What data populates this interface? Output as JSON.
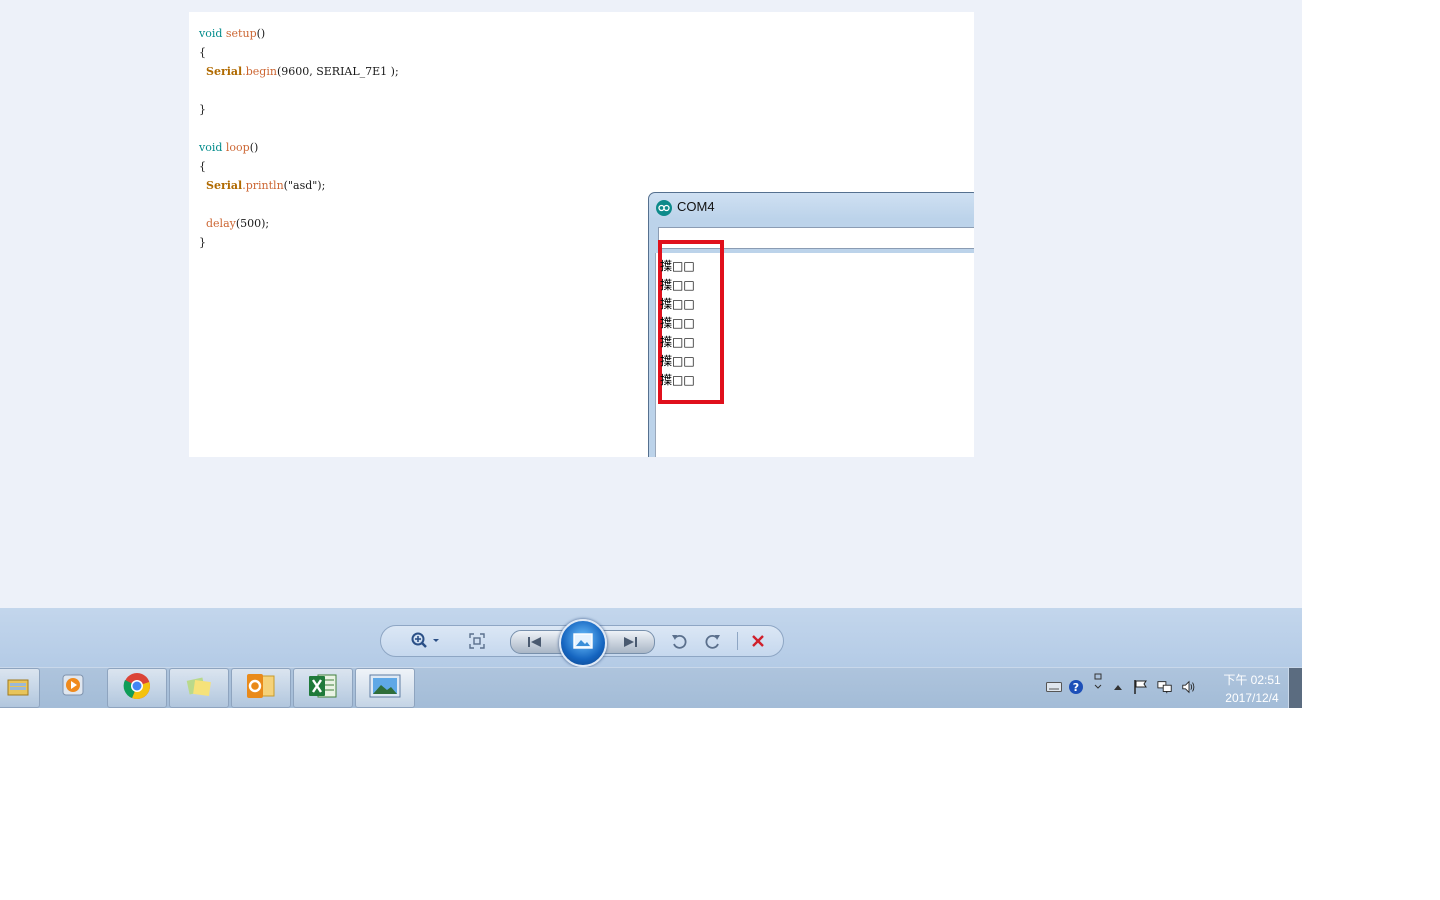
{
  "code": {
    "lines": [
      {
        "kw": "void",
        "fn": "setup",
        "rest": "()"
      },
      {
        "rest": "{"
      },
      {
        "indent": "  ",
        "cls": "Serial",
        "fn": ".begin",
        "rest": "(9600, SERIAL_7E1 );"
      },
      {
        "rest": ""
      },
      {
        "rest": "}"
      },
      {
        "rest": ""
      },
      {
        "kw": "void",
        "fn": "loop",
        "rest": "()"
      },
      {
        "rest": "{"
      },
      {
        "indent": "  ",
        "cls": "Serial",
        "fn": ".println",
        "rest": "(\"asd\");"
      },
      {
        "rest": ""
      },
      {
        "indent": "  ",
        "fn": "delay",
        "rest": "(500);"
      },
      {
        "rest": "}"
      }
    ]
  },
  "serial_monitor": {
    "title": "COM4",
    "icon": "arduino-icon",
    "output_lines": [
      "擛□□",
      "擛□□",
      "擛□□",
      "擛□□",
      "擛□□",
      "擛□□",
      "擛□□"
    ],
    "highlight_color": "#e0101c"
  },
  "viewer_toolbar": {
    "zoom": "zoom-icon",
    "fit": "actual-size-icon",
    "previous": "previous-icon",
    "slideshow": "slideshow-icon",
    "next": "next-icon",
    "rotate_left": "rotate-ccw-icon",
    "rotate_right": "rotate-cw-icon",
    "delete": "delete-icon"
  },
  "taskbar": {
    "apps": [
      "file-explorer-icon",
      "media-player-icon",
      "chrome-icon",
      "sticky-notes-icon",
      "outlook-icon",
      "excel-icon",
      "photo-viewer-icon"
    ],
    "tray": {
      "clock_time": "下午 02:51",
      "clock_date": "2017/12/4"
    }
  },
  "colors": {
    "viewer_bg": "#edf1f9",
    "keyword": "#008b8b",
    "function": "#cc6633",
    "class": "#b06a00"
  }
}
